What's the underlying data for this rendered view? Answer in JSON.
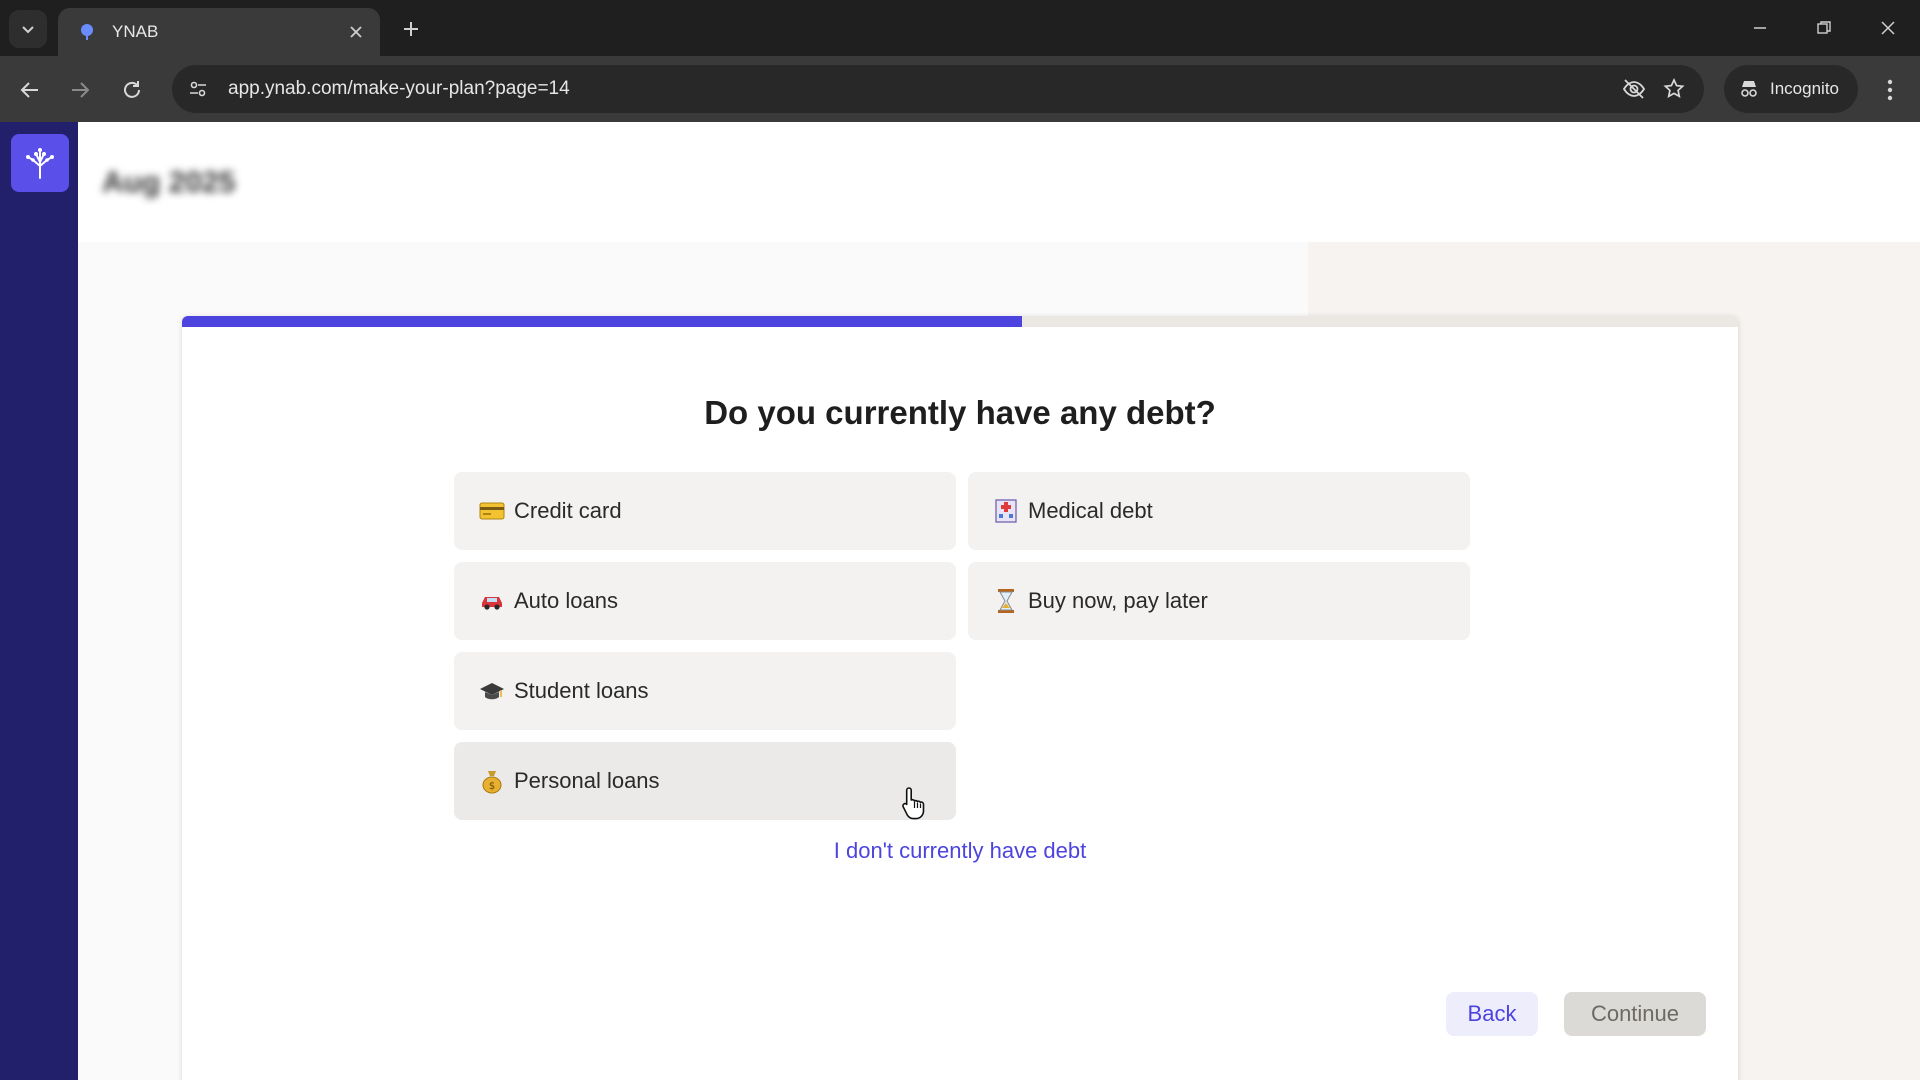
{
  "browser": {
    "tab_title": "YNAB",
    "url": "app.ynab.com/make-your-plan?page=14",
    "incognito_label": "Incognito"
  },
  "app": {
    "month_label": "Aug 2025",
    "progress_fraction": 0.54,
    "question": "Do you currently have any debt?",
    "options": [
      {
        "label": "Credit card",
        "icon": "credit-card-icon"
      },
      {
        "label": "Medical debt",
        "icon": "hospital-icon"
      },
      {
        "label": "Auto loans",
        "icon": "car-icon"
      },
      {
        "label": "Buy now, pay later",
        "icon": "hourglass-icon"
      },
      {
        "label": "Student loans",
        "icon": "graduation-cap-icon"
      },
      {
        "label": "Personal loans",
        "icon": "money-bag-icon"
      }
    ],
    "no_debt_link": "I don't currently have debt",
    "back_label": "Back",
    "continue_label": "Continue"
  },
  "colors": {
    "accent": "#4d44e0",
    "sidebar": "#22206b",
    "logo_bg": "#5b4fe9"
  }
}
